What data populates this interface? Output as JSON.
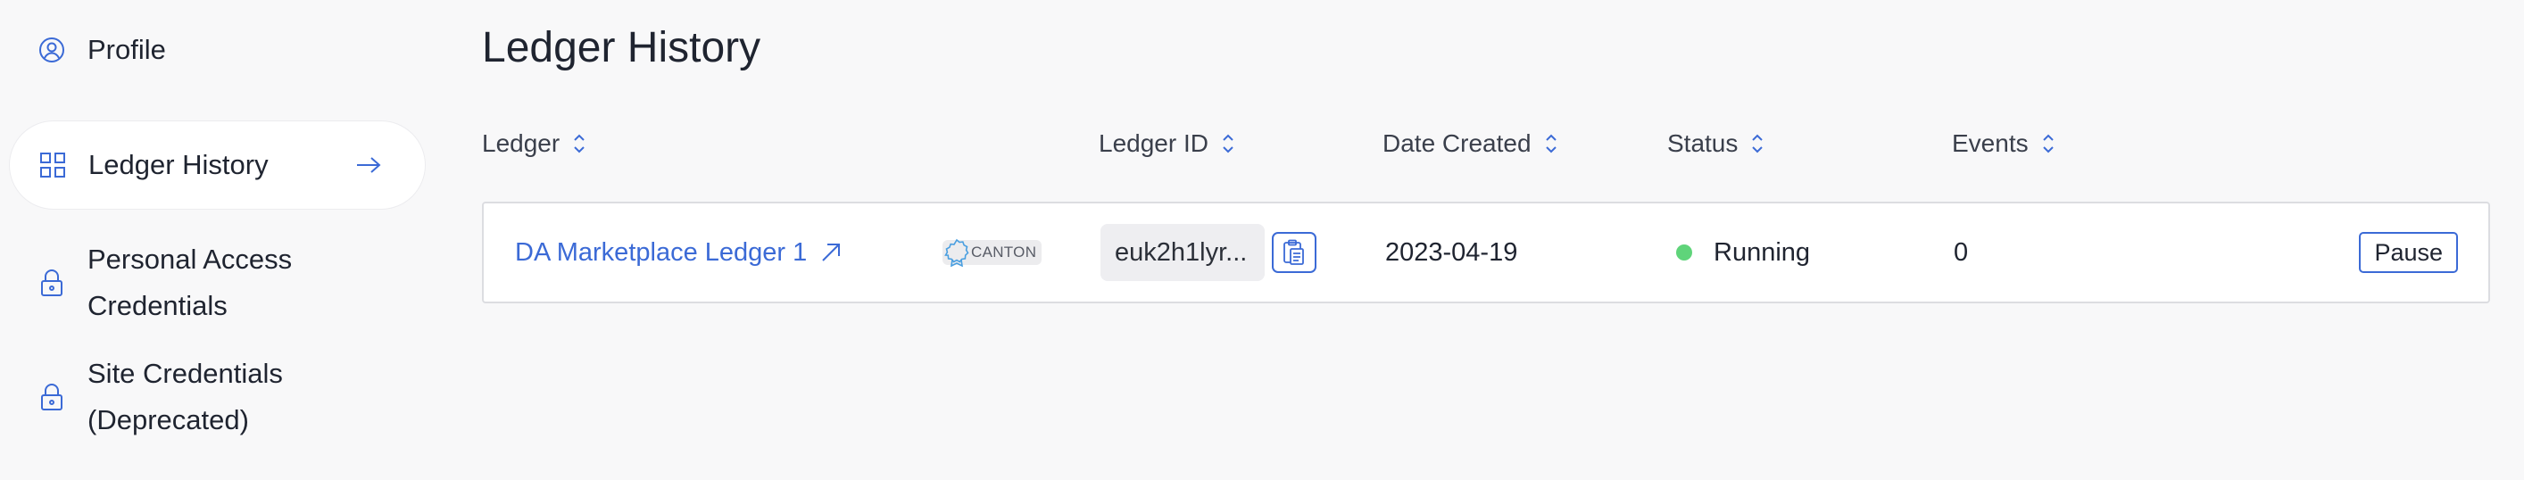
{
  "sidebar": {
    "items": [
      {
        "label": "Profile",
        "icon": "user-circle-icon"
      },
      {
        "label": "Ledger History",
        "icon": "grid-icon",
        "active": true
      },
      {
        "label": "Personal Access Credentials",
        "icon": "lock-icon"
      },
      {
        "label": "Site Credentials (Deprecated)",
        "icon": "lock-icon"
      }
    ]
  },
  "main": {
    "title": "Ledger History",
    "columns": [
      "Ledger",
      "Ledger ID",
      "Date Created",
      "Status",
      "Events"
    ],
    "rows": [
      {
        "ledger": "DA Marketplace Ledger 1",
        "badge": "CANTON",
        "ledger_id": "euk2h1lyr...",
        "date_created": "2023-04-19",
        "status": "Running",
        "status_color": "#5fd47a",
        "events": "0",
        "action": "Pause"
      }
    ]
  },
  "colors": {
    "accent": "#3b6ad6",
    "text": "#1f2430",
    "background": "#f8f8f9",
    "status_running": "#5fd47a"
  }
}
